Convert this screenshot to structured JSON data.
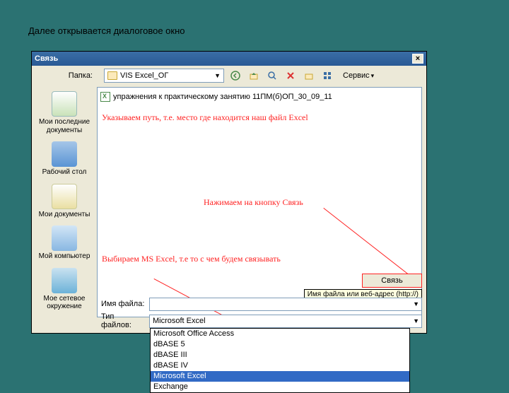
{
  "caption": "Далее открывается диалоговое окно",
  "dialog": {
    "title": "Связь"
  },
  "toolbar": {
    "folder_label": "Папка:",
    "folder_value": "VIS Excel_ОГ",
    "service_label": "Сервис"
  },
  "places": [
    {
      "label": "Мои последние документы"
    },
    {
      "label": "Рабочий стол"
    },
    {
      "label": "Мои документы"
    },
    {
      "label": "Мой компьютер"
    },
    {
      "label": "Мое сетевое окружение"
    }
  ],
  "file_item": "упражнения к практическому занятию 11ПМ(б)ОП_30_09_11",
  "annot": {
    "path": "Указываем путь, т.е. место где находится наш файл Excel",
    "btn": "Нажимаем на кнопку Связь",
    "type": "Выбираем MS Excel, т.е то с чем будем связывать"
  },
  "bottom": {
    "name_label": "Имя файла:",
    "name_value": "",
    "type_label": "Тип файлов:",
    "type_value": "Microsoft Excel",
    "link_button": "Связь",
    "tooltip": "Имя файла или веб-адрес (http://)"
  },
  "type_options": [
    "Microsoft Office Access",
    "dBASE 5",
    "dBASE III",
    "dBASE IV",
    "Microsoft Excel",
    "Exchange"
  ]
}
